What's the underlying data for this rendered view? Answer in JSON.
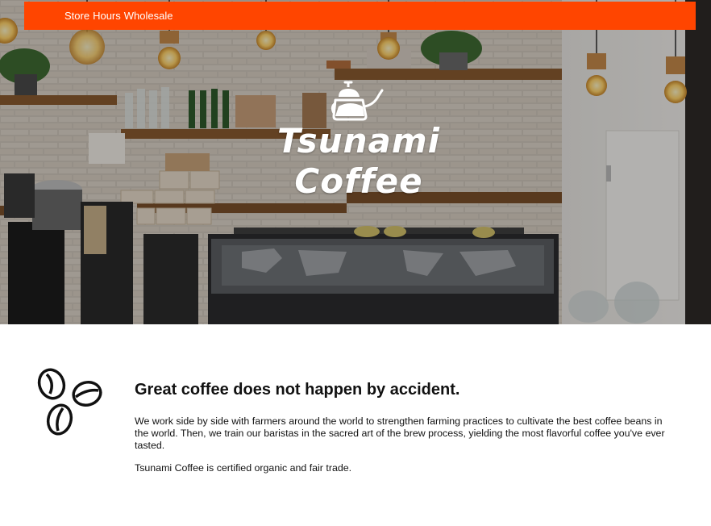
{
  "nav": {
    "links": [
      "Store",
      "Hours",
      "Wholesale"
    ],
    "color": "#ff4500"
  },
  "hero": {
    "logo_line1": "Tsunami",
    "logo_line2": "Coffee",
    "icon": "kettle-icon"
  },
  "main": {
    "icon": "coffee-beans-icon",
    "headline": "Great coffee does not happen by accident.",
    "paragraph1": "We work side by side with farmers around the world to strengthen farming practices to cultivate the best coffee beans in the world. Then, we train our baristas in the sacred art of the brew process, yielding the most flavorful coffee you've ever tasted.",
    "paragraph2": "Tsunami Coffee is certified organic and fair trade."
  }
}
